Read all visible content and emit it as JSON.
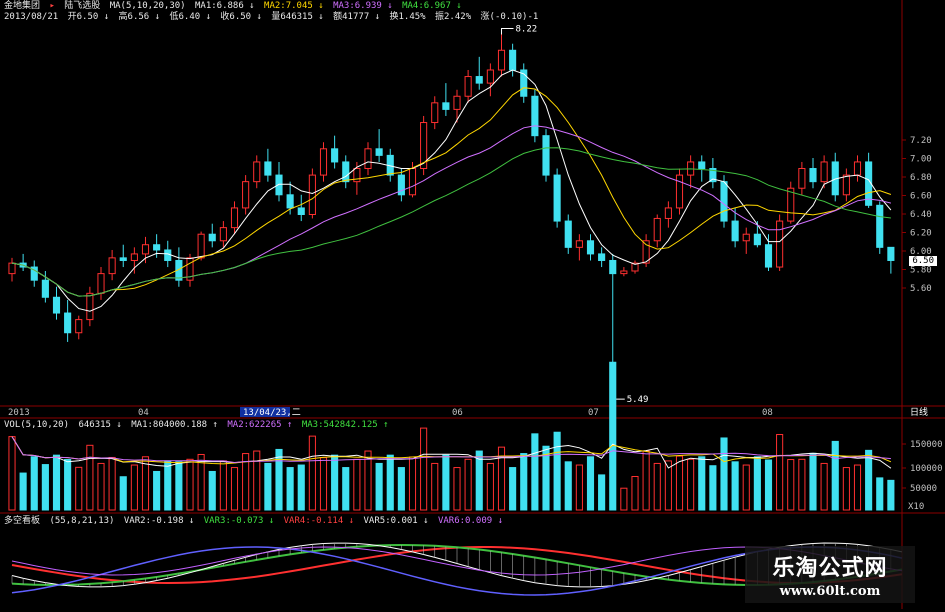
{
  "header": {
    "stock_name": "金地集团",
    "indicator_name": "陆飞选股",
    "ma_params": "MA(5,10,20,30)",
    "ma1": "MA1:6.886 ↓",
    "ma2": "MA2:7.045 ↓",
    "ma3": "MA3:6.939 ↓",
    "ma4": "MA4:6.967 ↓",
    "date": "2013/08/21",
    "open": "开6.50 ↓",
    "high": "高6.56 ↓",
    "low": "低6.40 ↓",
    "close": "收6.50 ↓",
    "volume": "量646315 ↓",
    "amount": "额41777 ↓",
    "turnover": "换1.45%",
    "amplitude": "振2.42%",
    "change": "涨(-0.10)-1"
  },
  "price_axis": {
    "ticks": [
      "7.20",
      "7.00",
      "6.80",
      "6.60",
      "6.40",
      "6.20",
      "6.00",
      "5.80",
      "5.60"
    ],
    "current": "6.50"
  },
  "annotations": {
    "high_mark": "8.22",
    "low_mark": "5.49"
  },
  "time_axis": {
    "labels": [
      "2013",
      "04",
      "06",
      "07",
      "08"
    ],
    "selected": "13/04/23,二",
    "period": "日线"
  },
  "volume_panel": {
    "label": "VOL(5,10,20)",
    "value": "646315 ↓",
    "ma1": "MA1:804000.188 ↑",
    "ma2": "MA2:622265 ↑",
    "ma3": "MA3:542842.125 ↑",
    "ticks": [
      "150000",
      "100000",
      "50000"
    ],
    "unit": "X10"
  },
  "indicator_panel": {
    "label": "多空看板",
    "params": "(55,8,21,13)",
    "var2": "VAR2:-0.198 ↓",
    "var3": "VAR3:-0.073 ↓",
    "var4": "VAR4:-0.114 ↓",
    "var5": "VAR5:0.001 ↓",
    "var6": "VAR6:0.009 ↓"
  },
  "watermark": {
    "title": "乐淘公式网",
    "url": "www.60lt.com"
  },
  "colors": {
    "up": "#ff3030",
    "down": "#40e0f0",
    "ma1": "#ffffff",
    "ma2": "#ffd700",
    "ma3": "#d070ff",
    "ma4": "#40c040",
    "grid": "#8b0000"
  },
  "chart_data": [
    {
      "type": "candlestick",
      "title": "",
      "ylim": [
        5.4,
        7.35
      ],
      "ohlc": [
        [
          6.4,
          6.52,
          6.34,
          6.48
        ],
        [
          6.48,
          6.55,
          6.42,
          6.45
        ],
        [
          6.45,
          6.5,
          6.3,
          6.35
        ],
        [
          6.35,
          6.42,
          6.18,
          6.22
        ],
        [
          6.22,
          6.3,
          6.05,
          6.1
        ],
        [
          6.1,
          6.2,
          5.88,
          5.95
        ],
        [
          5.95,
          6.08,
          5.9,
          6.05
        ],
        [
          6.05,
          6.3,
          6.0,
          6.25
        ],
        [
          6.25,
          6.45,
          6.2,
          6.4
        ],
        [
          6.4,
          6.58,
          6.35,
          6.52
        ],
        [
          6.52,
          6.62,
          6.45,
          6.5
        ],
        [
          6.5,
          6.6,
          6.4,
          6.55
        ],
        [
          6.55,
          6.68,
          6.48,
          6.62
        ],
        [
          6.62,
          6.7,
          6.52,
          6.58
        ],
        [
          6.58,
          6.65,
          6.45,
          6.5
        ],
        [
          6.5,
          6.6,
          6.3,
          6.35
        ],
        [
          6.35,
          6.55,
          6.3,
          6.52
        ],
        [
          6.52,
          6.72,
          6.5,
          6.7
        ],
        [
          6.7,
          6.78,
          6.6,
          6.65
        ],
        [
          6.65,
          6.8,
          6.6,
          6.75
        ],
        [
          6.75,
          6.95,
          6.7,
          6.9
        ],
        [
          6.9,
          7.15,
          6.85,
          7.1
        ],
        [
          7.1,
          7.3,
          7.05,
          7.25
        ],
        [
          7.25,
          7.35,
          7.1,
          7.15
        ],
        [
          7.15,
          7.25,
          6.95,
          7.0
        ],
        [
          7.0,
          7.1,
          6.85,
          6.9
        ],
        [
          6.9,
          7.0,
          6.8,
          6.85
        ],
        [
          6.85,
          7.2,
          6.82,
          7.15
        ],
        [
          7.15,
          7.4,
          7.1,
          7.35
        ],
        [
          7.35,
          7.45,
          7.2,
          7.25
        ],
        [
          7.25,
          7.3,
          7.05,
          7.1
        ],
        [
          7.1,
          7.25,
          7.0,
          7.2
        ],
        [
          7.2,
          7.4,
          7.15,
          7.35
        ],
        [
          7.35,
          7.5,
          7.25,
          7.3
        ],
        [
          7.3,
          7.35,
          7.1,
          7.15
        ],
        [
          7.15,
          7.2,
          6.95,
          7.0
        ],
        [
          7.0,
          7.25,
          6.98,
          7.2
        ],
        [
          7.2,
          7.6,
          7.15,
          7.55
        ],
        [
          7.55,
          7.75,
          7.5,
          7.7
        ],
        [
          7.7,
          7.85,
          7.6,
          7.65
        ],
        [
          7.65,
          7.8,
          7.55,
          7.75
        ],
        [
          7.75,
          7.95,
          7.7,
          7.9
        ],
        [
          7.9,
          8.05,
          7.8,
          7.85
        ],
        [
          7.85,
          8.0,
          7.75,
          7.95
        ],
        [
          7.95,
          8.22,
          7.9,
          8.1
        ],
        [
          8.1,
          8.15,
          7.9,
          7.95
        ],
        [
          7.95,
          8.0,
          7.7,
          7.75
        ],
        [
          7.75,
          7.8,
          7.4,
          7.45
        ],
        [
          7.45,
          7.5,
          7.1,
          7.15
        ],
        [
          7.15,
          7.2,
          6.75,
          6.8
        ],
        [
          6.8,
          6.85,
          6.55,
          6.6
        ],
        [
          6.6,
          6.7,
          6.5,
          6.65
        ],
        [
          6.65,
          6.7,
          6.5,
          6.55
        ],
        [
          6.55,
          6.6,
          6.45,
          6.5
        ],
        [
          6.5,
          6.55,
          5.49,
          6.4
        ],
        [
          6.4,
          6.45,
          6.38,
          6.42
        ],
        [
          6.42,
          6.5,
          6.4,
          6.48
        ],
        [
          6.48,
          6.7,
          6.45,
          6.65
        ],
        [
          6.65,
          6.85,
          6.6,
          6.82
        ],
        [
          6.82,
          6.95,
          6.75,
          6.9
        ],
        [
          6.9,
          7.2,
          6.85,
          7.15
        ],
        [
          7.15,
          7.3,
          7.05,
          7.25
        ],
        [
          7.25,
          7.3,
          7.1,
          7.2
        ],
        [
          7.2,
          7.28,
          7.05,
          7.1
        ],
        [
          7.1,
          7.15,
          6.75,
          6.8
        ],
        [
          6.8,
          6.9,
          6.6,
          6.65
        ],
        [
          6.65,
          6.75,
          6.55,
          6.7
        ],
        [
          6.7,
          6.8,
          6.6,
          6.62
        ],
        [
          6.62,
          6.7,
          6.42,
          6.45
        ],
        [
          6.45,
          6.85,
          6.42,
          6.8
        ],
        [
          6.8,
          7.1,
          6.78,
          7.05
        ],
        [
          7.05,
          7.25,
          7.0,
          7.2
        ],
        [
          7.2,
          7.28,
          7.05,
          7.1
        ],
        [
          7.1,
          7.3,
          7.05,
          7.25
        ],
        [
          7.25,
          7.32,
          6.95,
          7.0
        ],
        [
          7.0,
          7.2,
          6.95,
          7.15
        ],
        [
          7.15,
          7.3,
          7.1,
          7.25
        ],
        [
          7.25,
          7.32,
          6.9,
          6.92
        ],
        [
          6.92,
          6.95,
          6.55,
          6.6
        ],
        [
          6.6,
          6.56,
          6.4,
          6.5
        ]
      ]
    }
  ]
}
